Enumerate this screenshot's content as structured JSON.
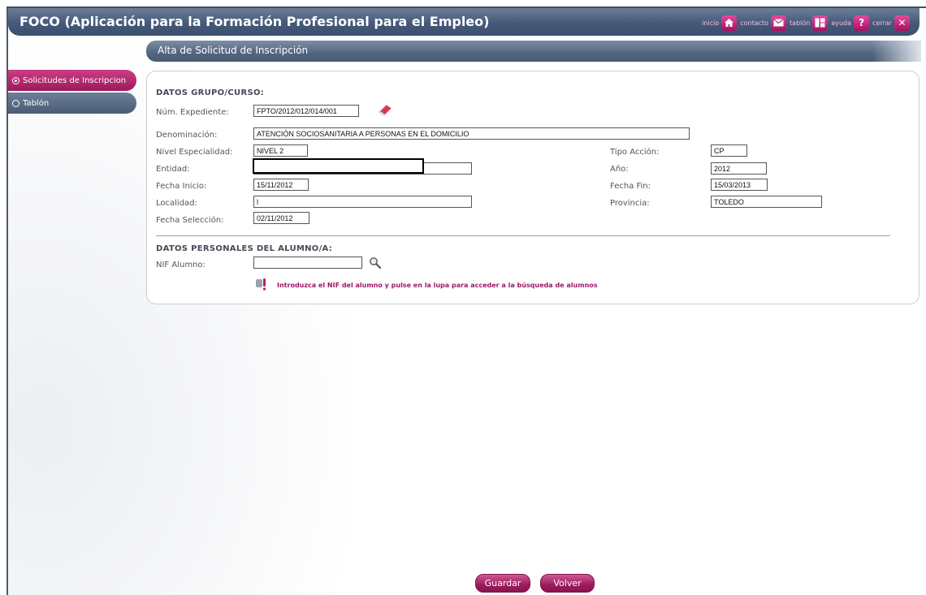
{
  "header": {
    "app_title": "FOCO (Aplicación para la Formación Profesional para el Empleo)",
    "links": [
      {
        "label": "inicio",
        "icon": "home-icon"
      },
      {
        "label": "contacto",
        "icon": "mail-icon"
      },
      {
        "label": "tablón",
        "icon": "board-icon"
      },
      {
        "label": "ayuda",
        "icon": "help-icon"
      },
      {
        "label": "cerrar",
        "icon": "close-icon"
      }
    ]
  },
  "page": {
    "title": "Alta de Solicitud de Inscripción"
  },
  "sidebar": {
    "items": [
      {
        "label": "Solicitudes de Inscripcion",
        "active": true
      },
      {
        "label": "Tablón",
        "active": false
      }
    ]
  },
  "grupo": {
    "section_title": "DATOS GRUPO/CURSO:",
    "num_expediente": {
      "label": "Núm. Expediente:",
      "value": "FPTO/2012/012/014/001"
    },
    "denominacion": {
      "label": "Denominación:",
      "value": "ATENCIÓN SOCIOSANITARIA A PERSONAS EN EL DOMICILIO"
    },
    "nivel": {
      "label": "Nivel Especialidad:",
      "value": "NIVEL 2"
    },
    "tipo_accion": {
      "label": "Tipo Acción:",
      "value": "CP"
    },
    "entidad": {
      "label": "Entidad:",
      "value": ""
    },
    "anio": {
      "label": "Año:",
      "value": "2012"
    },
    "fecha_inicio": {
      "label": "Fecha Inicio:",
      "value": "15/11/2012"
    },
    "fecha_fin": {
      "label": "Fecha Fin:",
      "value": "15/03/2013"
    },
    "localidad": {
      "label": "Localidad:",
      "value": "l"
    },
    "provincia": {
      "label": "Provincia:",
      "value": "TOLEDO"
    },
    "fecha_seleccion": {
      "label": "Fecha Selección:",
      "value": "02/11/2012"
    }
  },
  "alumno": {
    "section_title": "DATOS PERSONALES DEL ALUMNO/A:",
    "nif": {
      "label": "NIF Alumno:",
      "value": ""
    },
    "info": "Introduzca el NIF del alumno y pulse en la lupa para acceder a la búsqueda de alumnos"
  },
  "buttons": {
    "save": "Guardar",
    "back": "Volver"
  },
  "colors": {
    "header_blue": "#45597a",
    "accent_magenta": "#a8105d",
    "info_text": "#a0176a"
  }
}
